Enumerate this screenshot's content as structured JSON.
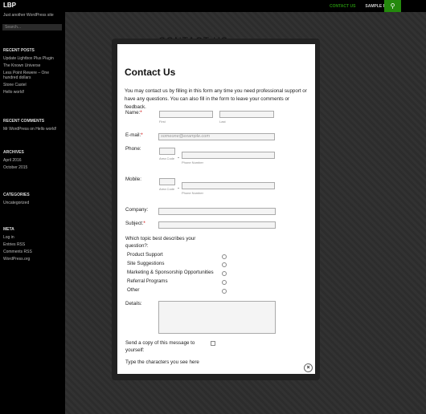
{
  "site": {
    "title": "LBP",
    "tagline": "Just another WordPress site",
    "search_placeholder": "Search..."
  },
  "nav": {
    "items": [
      "CONTACT US",
      "SAMPLE PAGE"
    ],
    "search_icon": "search-icon"
  },
  "sidebar": {
    "recent_posts": {
      "heading": "RECENT POSTS",
      "items": [
        "Update Lightbox Plus Plugin",
        "The Known Universe",
        "Less Point Rewere – One hundred dollars",
        "Stone Castel",
        "Hello world!"
      ]
    },
    "recent_comments": {
      "heading": "RECENT COMMENTS",
      "items": [
        "Mr WordPress on Hello world!"
      ]
    },
    "archives": {
      "heading": "ARCHIVES",
      "items": [
        "April 2016",
        "October 2015"
      ]
    },
    "categories": {
      "heading": "CATEGORIES",
      "items": [
        "Uncategorized"
      ]
    },
    "meta": {
      "heading": "META",
      "items": [
        "Log in",
        "Entries RSS",
        "Comments RSS",
        "WordPress.org"
      ]
    }
  },
  "page": {
    "background_title": "CONTACT US"
  },
  "modal": {
    "title": "Contact Us",
    "intro": "You may contact us by filling in this form any time you need professional support or have any questions. You can also fill in the form to leave your comments or feedback.",
    "name_label": "Name:",
    "required_mark": "*",
    "first_sub": "First",
    "last_sub": "Last",
    "email_label": "E-mail:",
    "email_placeholder": "someone@example.com",
    "phone_label": "Phone:",
    "mobile_label": "Mobile:",
    "area_code_sub": "Area Code",
    "phone_number_sub": "Phone Number",
    "dash": "-",
    "company_label": "Company:",
    "subject_label": "Subject:",
    "topic_question": "Which topic best describes your question?:",
    "topics": [
      "Product Support",
      "Site Suggestions",
      "Marketing & Sponsorship Opportunities",
      "Referral Programs",
      "Other"
    ],
    "details_label": "Details:",
    "copy_label": "Send a copy of this message to yourself:",
    "captcha_label": "Type the characters you see here",
    "close_icon": "close-icon",
    "close_glyph": "×"
  }
}
